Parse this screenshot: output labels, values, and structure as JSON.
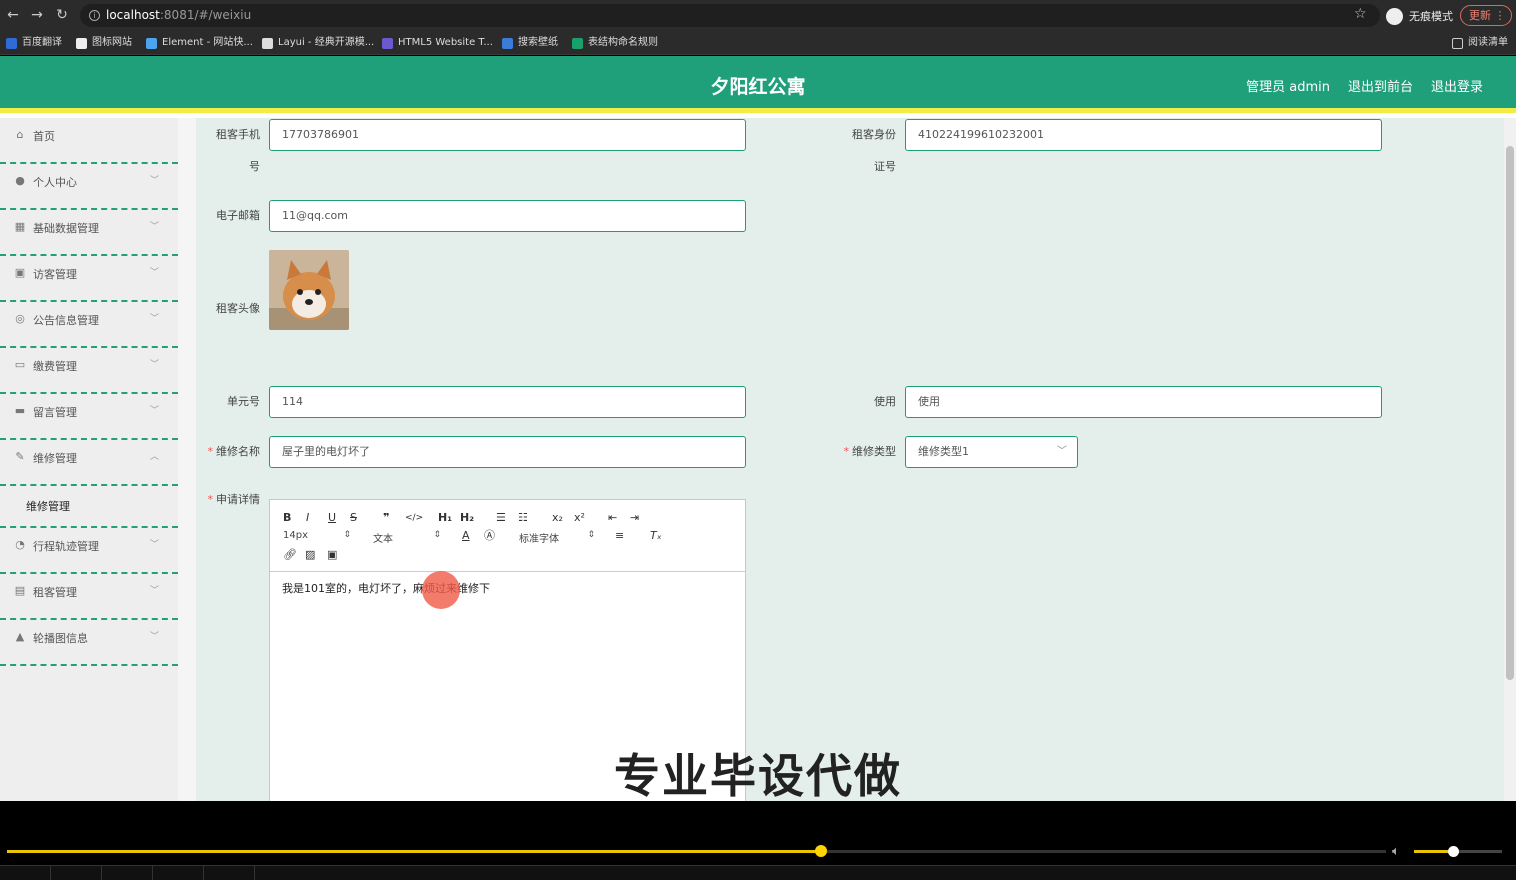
{
  "browser": {
    "url_host": "localhost",
    "url_rest": ":8081/#/weixiu",
    "profile_label": "无痕模式",
    "update_label": "更新",
    "bookmarks": [
      {
        "label": "百度翻译",
        "color": "#2f6bd8"
      },
      {
        "label": "图标网站",
        "color": "#eeeeee"
      },
      {
        "label": "Element - 网站快...",
        "color": "#4ba3f2"
      },
      {
        "label": "Layui - 经典开源模...",
        "color": "#dddddd"
      },
      {
        "label": "HTML5 Website T...",
        "color": "#6a5acd"
      },
      {
        "label": "搜索壁纸",
        "color": "#3b7bd9"
      },
      {
        "label": "表结构命名规则",
        "color": "#1aa06a"
      }
    ],
    "reading_list": "阅读清单"
  },
  "header": {
    "title": "夕阳红公寓",
    "admin_label": "管理员 admin",
    "frontend_label": "退出到前台",
    "logout_label": "退出登录"
  },
  "sidebar": {
    "items": [
      {
        "label": "首页",
        "icon": "home-icon",
        "glyph": "⌂"
      },
      {
        "label": "个人中心",
        "icon": "user-icon",
        "glyph": "●"
      },
      {
        "label": "基础数据管理",
        "icon": "grid-icon",
        "glyph": "▦"
      },
      {
        "label": "访客管理",
        "icon": "calendar-icon",
        "glyph": "▣"
      },
      {
        "label": "公告信息管理",
        "icon": "compass-icon",
        "glyph": "◎"
      },
      {
        "label": "缴费管理",
        "icon": "message-icon",
        "glyph": "▭"
      },
      {
        "label": "留言管理",
        "icon": "briefcase-icon",
        "glyph": "▬"
      },
      {
        "label": "维修管理",
        "icon": "tool-icon",
        "glyph": "✎"
      },
      {
        "label": "行程轨迹管理",
        "icon": "power-icon",
        "glyph": "◔"
      },
      {
        "label": "租客管理",
        "icon": "document-icon",
        "glyph": "▤"
      },
      {
        "label": "轮播图信息",
        "icon": "person-icon",
        "glyph": "▲"
      }
    ],
    "sub_item": "维修管理"
  },
  "form": {
    "phone_label_1": "租客手机",
    "phone_label_2": "号",
    "phone_value": "17703786901",
    "idcard_label_1": "租客身份",
    "idcard_label_2": "证号",
    "idcard_value": "410224199610232001",
    "email_label": "电子邮箱",
    "email_value": "11@qq.com",
    "avatar_label": "租客头像",
    "unit_label": "单元号",
    "unit_value": "114",
    "use_label": "使用",
    "use_value": "使用",
    "repair_name_label": "维修名称",
    "repair_name_value": "屋子里的电灯坏了",
    "repair_type_label": "维修类型",
    "repair_type_value": "维修类型1",
    "detail_label": "申请详情"
  },
  "editor": {
    "font_size": "14px",
    "text_style": "文本",
    "font_family": "标准字体",
    "content": "我是101室的，电灯坏了，麻烦过来维修下"
  },
  "watermark": "专业毕设代做",
  "player": {
    "progress": 0.59,
    "volume": 0.44
  }
}
